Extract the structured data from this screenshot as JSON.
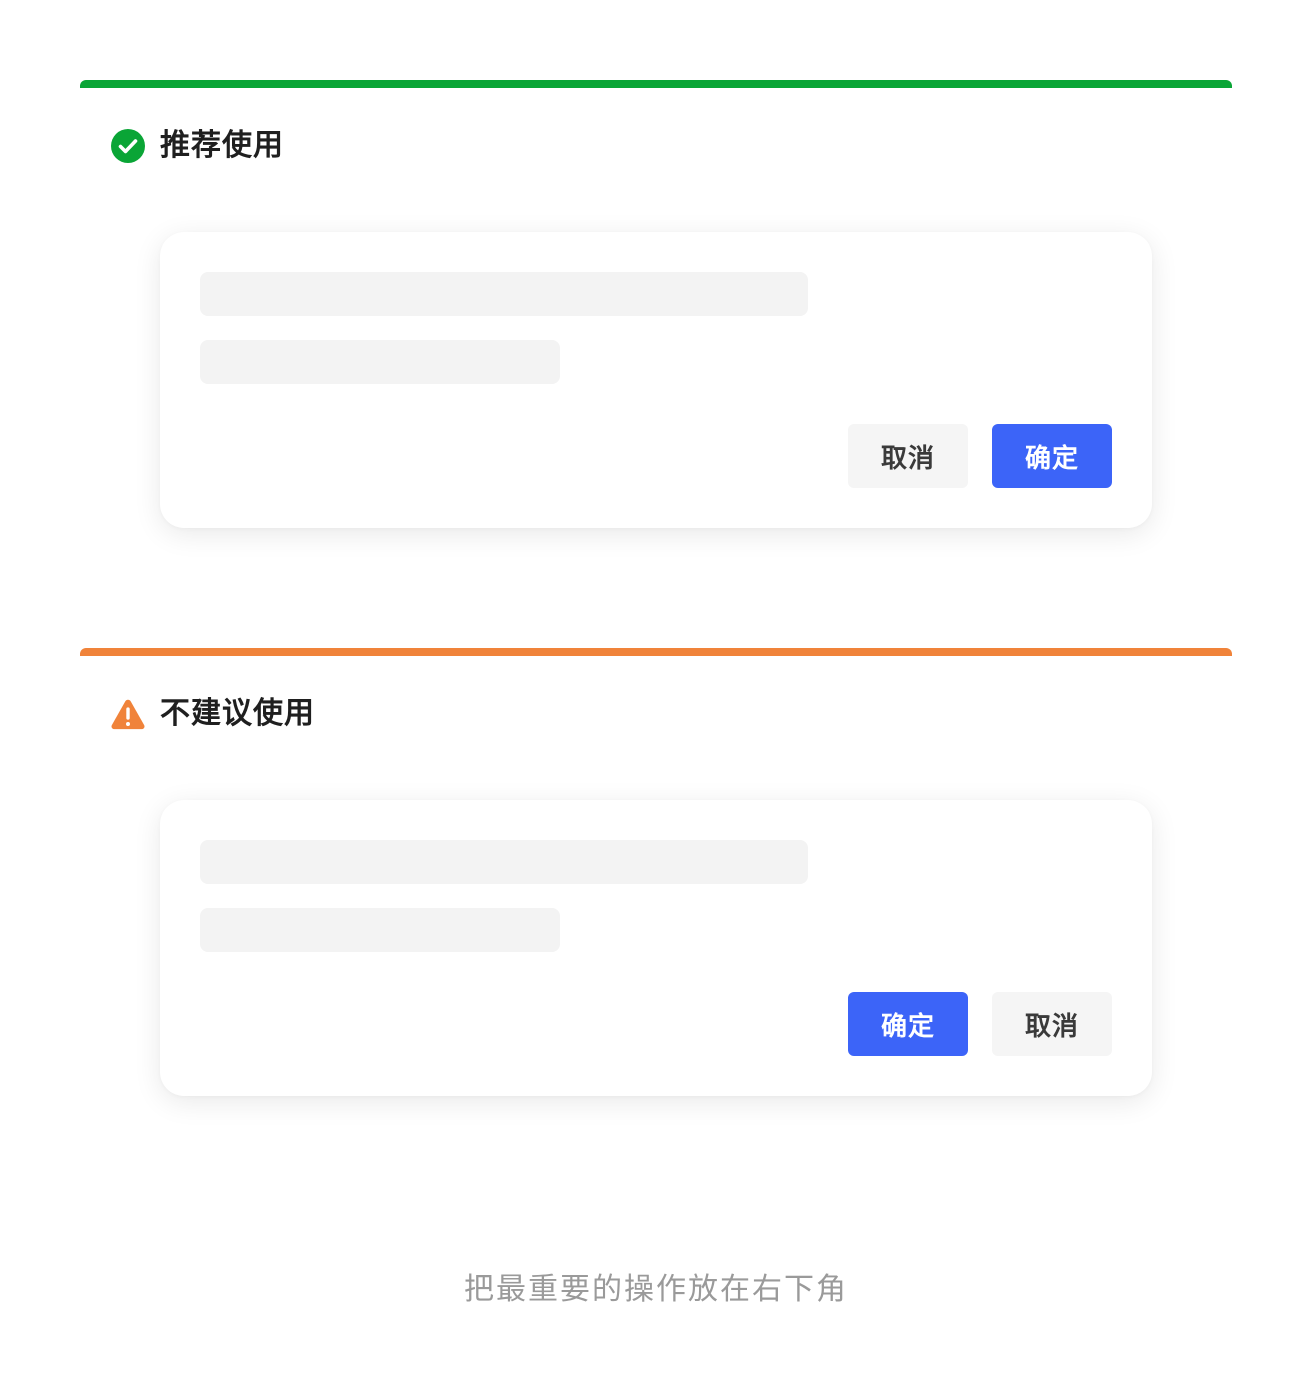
{
  "colors": {
    "good": "#0aa536",
    "bad": "#f0833a",
    "primary_button": "#3c64f8",
    "secondary_button": "#f5f5f5",
    "skeleton": "#f3f3f3"
  },
  "good": {
    "icon": "check-circle-icon",
    "title": "推荐使用",
    "buttons": {
      "cancel": "取消",
      "confirm": "确定"
    }
  },
  "bad": {
    "icon": "warning-triangle-icon",
    "title": "不建议使用",
    "buttons": {
      "confirm": "确定",
      "cancel": "取消"
    }
  },
  "caption": "把最重要的操作放在右下角"
}
